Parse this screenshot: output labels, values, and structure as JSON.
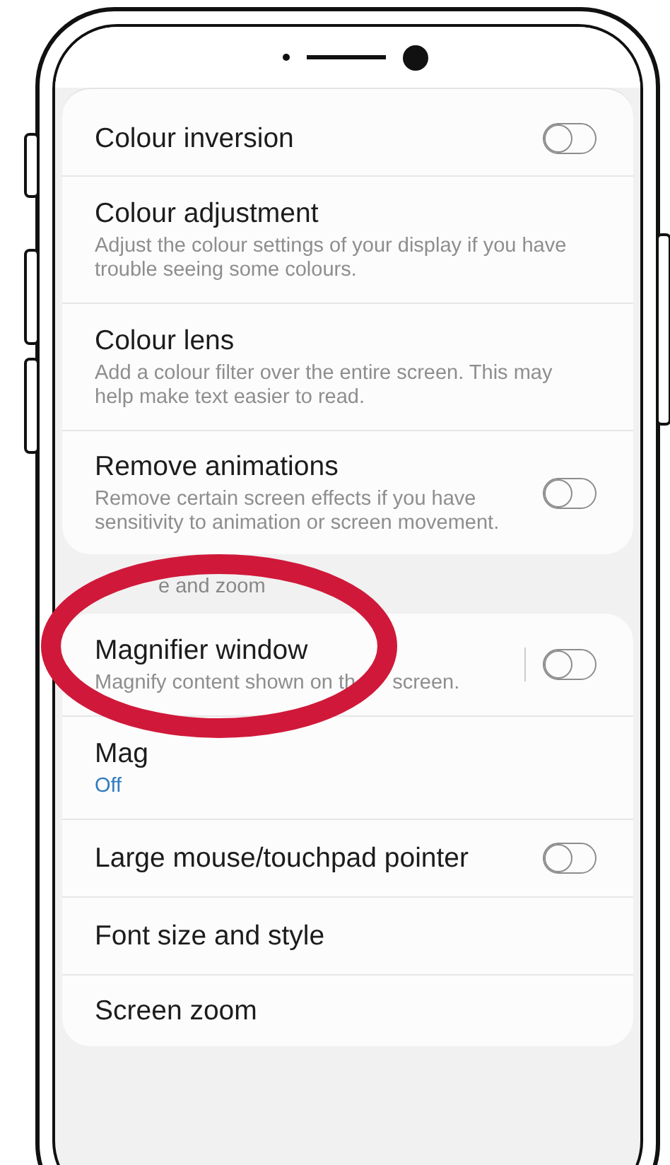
{
  "sections": [
    {
      "rows": [
        {
          "kind": "toggle",
          "title": "Colour inversion",
          "on": false
        },
        {
          "kind": "plain",
          "title": "Colour adjustment",
          "description": [
            "Adjust the colour settings of your display if you have trouble seeing some colours."
          ]
        },
        {
          "kind": "plain",
          "title": "Colour lens",
          "description": [
            "Add a colour filter over the entire screen. This may help make text easier to read."
          ]
        },
        {
          "kind": "toggle",
          "title": "Remove animations",
          "description": [
            "Remove certain screen effects if you have sensitivity to animation or screen movement."
          ],
          "on": false
        }
      ]
    },
    {
      "header": "e and zoom",
      "rows": [
        {
          "kind": "split-toggle",
          "title": "Magnifier window",
          "description": [
            "Magnify content shown on th",
            "screen."
          ],
          "on": false
        },
        {
          "kind": "value",
          "title": "Mag",
          "value": "Off"
        },
        {
          "kind": "toggle",
          "title": "Large mouse/touchpad pointer",
          "on": false
        },
        {
          "kind": "plain",
          "title": "Font size and style"
        },
        {
          "kind": "plain",
          "title": "Screen zoom"
        }
      ]
    }
  ]
}
